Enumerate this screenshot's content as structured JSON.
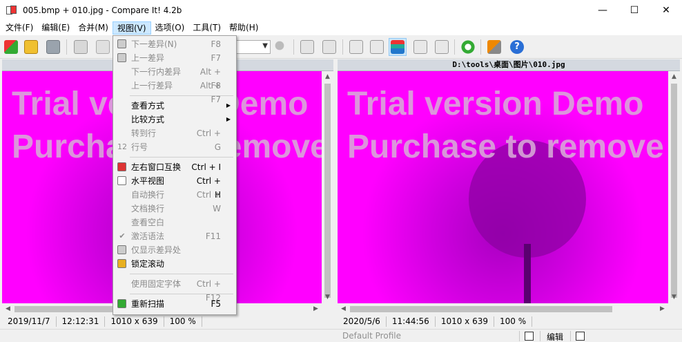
{
  "window": {
    "title": "005.bmp + 010.jpg - Compare It! 4.2b"
  },
  "menubar": [
    "文件(F)",
    "编辑(E)",
    "合并(M)",
    "视图(V)",
    "选项(O)",
    "工具(T)",
    "帮助(H)"
  ],
  "view_menu": [
    {
      "label": "下一差异(N)",
      "shortcut": "F8",
      "disabled": true,
      "icon": "next-diff-icon"
    },
    {
      "label": "上一差异",
      "shortcut": "F7",
      "disabled": true,
      "icon": "prev-diff-icon"
    },
    {
      "label": "下一行内差异",
      "shortcut": "Alt + F8",
      "disabled": true
    },
    {
      "label": "上一行差异",
      "shortcut": "Alt + F7",
      "disabled": true
    },
    {
      "sep": true
    },
    {
      "label": "查看方式",
      "submenu": true,
      "disabled": false
    },
    {
      "label": "比较方式",
      "submenu": true,
      "disabled": false
    },
    {
      "label": "转到行",
      "shortcut": "Ctrl + G",
      "disabled": true
    },
    {
      "label": "行号",
      "disabled": true,
      "icon": "line-number-icon",
      "icon_text": "12"
    },
    {
      "sep": true
    },
    {
      "label": "左右窗口互换",
      "shortcut": "Ctrl + I",
      "disabled": false,
      "icon": "swap-icon"
    },
    {
      "label": "水平视图",
      "shortcut": "Ctrl + H",
      "disabled": false,
      "icon": "horizontal-view-icon"
    },
    {
      "label": "自动换行",
      "shortcut": "Ctrl + W",
      "disabled": true
    },
    {
      "label": "文档换行",
      "disabled": true
    },
    {
      "label": "查看空白",
      "disabled": true
    },
    {
      "label": "激活语法",
      "shortcut": "F11",
      "disabled": true,
      "icon": "check-icon",
      "icon_text": "✔"
    },
    {
      "label": "仅显示差异处",
      "disabled": true,
      "icon": "diff-only-icon"
    },
    {
      "label": "锁定滚动",
      "disabled": false,
      "icon": "lock-icon"
    },
    {
      "sep": true
    },
    {
      "label": "使用固定字体",
      "shortcut": "Ctrl + F12",
      "disabled": true
    },
    {
      "sep": true
    },
    {
      "label": "重新扫描",
      "shortcut": "F5",
      "disabled": false,
      "icon": "rescan-icon"
    }
  ],
  "left_pane": {
    "header": "",
    "watermark1": "Trial version Demo",
    "watermark2": "Purchase to remove",
    "date": "2019/11/7",
    "time": "12:12:31",
    "size": "1010 x 639",
    "zoom": "100 %"
  },
  "right_pane": {
    "header": "D:\\tools\\桌面\\图片\\010.jpg",
    "watermark1": "Trial version Demo",
    "watermark2": "Purchase to remove",
    "date": "2020/5/6",
    "time": "11:44:56",
    "size": "1010 x 639",
    "zoom": "100 %"
  },
  "statusbar": {
    "profile": "Default Profile",
    "edit_label": "编辑"
  },
  "colors": {
    "pane_bg": "#ff00ff",
    "menu_active": "#cce8ff",
    "pressed": "#cde6f7"
  }
}
